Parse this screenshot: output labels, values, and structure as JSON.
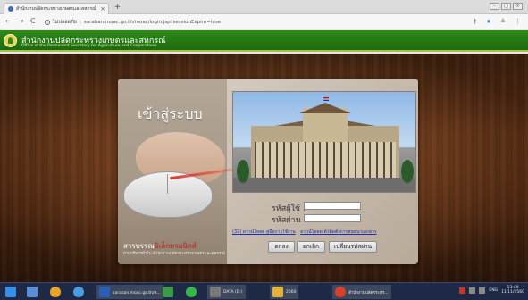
{
  "browser": {
    "tab_title": "สำนักงานปลัดกระทรวงเกษตรและสหกรณ์",
    "tab_close": "×",
    "new_tab": "+",
    "url_insecure": "ไม่ปลอดภัย",
    "url": "saraban.moac.go.th/moac/login.jsp?sessionExpire=true",
    "window_controls": [
      "–",
      "□",
      "×"
    ]
  },
  "site": {
    "name_th": "สำนักงานปลัดกระทรวงเกษตรและสหกรณ์",
    "name_en": "Office of the Permanent Secretary for Agriculture and Cooperatives"
  },
  "login": {
    "title": "เข้าสู่ระบบ",
    "username_label": "รหัสผู้ใช้ :",
    "password_label": "รหัสผ่าน :",
    "link_manual": "(32) ดาวน์โหลด คู่มือการใช้งาน",
    "link_program": "ดาวน์โหลด ตัวติดตั้งการสนทนาเอกสาร",
    "btn_login": "ตกลง",
    "btn_cancel": "ยกเลิก",
    "btn_change": "เปลี่ยนรหัสผ่าน",
    "caption_main_a": "สารบรรณ",
    "caption_main_b": "อิเล็กทรอนิกส์",
    "caption_sub": "ฝ่ายบริหารทั่วไป สำนักงานปลัดกระทรวงเกษตรและสหกรณ์"
  },
  "taskbar": {
    "items": [
      {
        "label": "saraban.moac.go.th/ต...",
        "color": "#2b5fb3"
      },
      {
        "label": "DATA (D:)",
        "color": "#7a7a7a"
      },
      {
        "label": "2560",
        "color": "#e3b43c"
      },
      {
        "label": "สำนักงานปลัดกระทร...",
        "color": "#d9402b"
      }
    ],
    "lang": "ENG",
    "time": "13:49",
    "date": "11/11/2560"
  },
  "colors": {
    "header_green": "#2f8a1a",
    "link_blue": "#1a2fae",
    "accent_red": "#c81b1b"
  }
}
